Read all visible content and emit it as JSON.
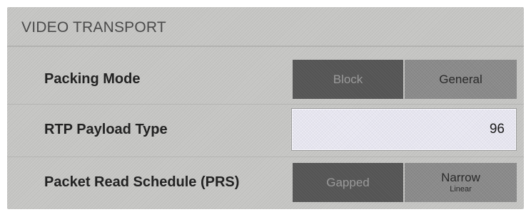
{
  "panel": {
    "title": "VIDEO TRANSPORT"
  },
  "packing_mode": {
    "label": "Packing Mode",
    "options": [
      "Block",
      "General"
    ],
    "selected": "Block"
  },
  "rtp_payload_type": {
    "label": "RTP Payload Type",
    "value": "96"
  },
  "packet_read_schedule": {
    "label": "Packet Read Schedule (PRS)",
    "options": [
      {
        "label": "Gapped"
      },
      {
        "label": "Narrow",
        "sublabel": "Linear"
      }
    ],
    "selected": "Gapped"
  }
}
